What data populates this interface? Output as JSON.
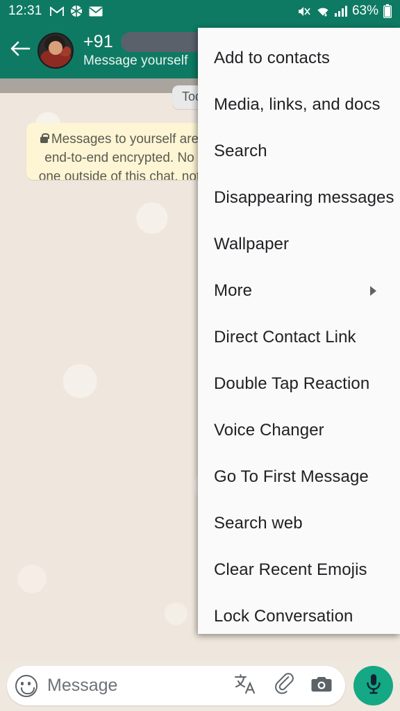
{
  "status_bar": {
    "time": "12:31",
    "left_icons": [
      "gmail-icon",
      "shutter-icon",
      "mail-icon"
    ],
    "right_icons": [
      "mute-icon",
      "wifi-icon",
      "signal-icon",
      "battery-icon"
    ],
    "battery": "63%"
  },
  "app_bar": {
    "back_icon": "back-arrow-icon",
    "avatar": "contact-avatar",
    "country_code": "+91",
    "phone_redacted": true,
    "subtitle": "Message yourself"
  },
  "chat": {
    "date_chip": "Today",
    "encryption_notice": "Messages to yourself are end-to-end encrypted. No one outside of this chat, not even WhatsApp, can read them. Tap to learn more.",
    "lock_icon": "lock-icon"
  },
  "menu": {
    "items": [
      {
        "label": "Add to contacts",
        "has_submenu": false
      },
      {
        "label": "Media, links, and docs",
        "has_submenu": false
      },
      {
        "label": "Search",
        "has_submenu": false
      },
      {
        "label": "Disappearing messages",
        "has_submenu": false
      },
      {
        "label": "Wallpaper",
        "has_submenu": false
      },
      {
        "label": "More",
        "has_submenu": true
      },
      {
        "label": "Direct Contact Link",
        "has_submenu": false
      },
      {
        "label": "Double Tap Reaction",
        "has_submenu": false
      },
      {
        "label": "Voice Changer",
        "has_submenu": false
      },
      {
        "label": "Go To First Message",
        "has_submenu": false
      },
      {
        "label": "Search web",
        "has_submenu": false
      },
      {
        "label": "Clear Recent Emojis",
        "has_submenu": false
      },
      {
        "label": "Lock Conversation",
        "has_submenu": false
      }
    ]
  },
  "composer": {
    "emoji_icon": "emoji-icon",
    "placeholder": "Message",
    "translate_icon": "translate-icon",
    "attach_icon": "paperclip-icon",
    "camera_icon": "camera-icon",
    "mic_icon": "microphone-icon"
  },
  "colors": {
    "brand_green": "#0F7A63",
    "accent_green": "#14A884",
    "wallpaper": "#EFE7DD",
    "menu_bg": "#FAFAFA",
    "notice_bg": "#FDF5D3"
  }
}
